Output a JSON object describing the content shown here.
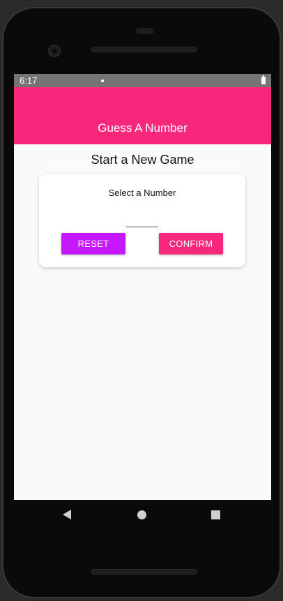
{
  "status_bar": {
    "time": "6:17"
  },
  "app_bar": {
    "title": "Guess A Number",
    "color": "#f7287b"
  },
  "screen": {
    "heading": "Start a New Game"
  },
  "card": {
    "label": "Select a Number",
    "input": {
      "value": "",
      "placeholder": ""
    },
    "buttons": {
      "reset_label": "RESET",
      "reset_color": "#c717fc",
      "confirm_label": "CONFIRM",
      "confirm_color": "#f7287b"
    }
  },
  "navigation": {
    "icons": [
      "back-icon",
      "home-icon",
      "recents-icon"
    ]
  }
}
